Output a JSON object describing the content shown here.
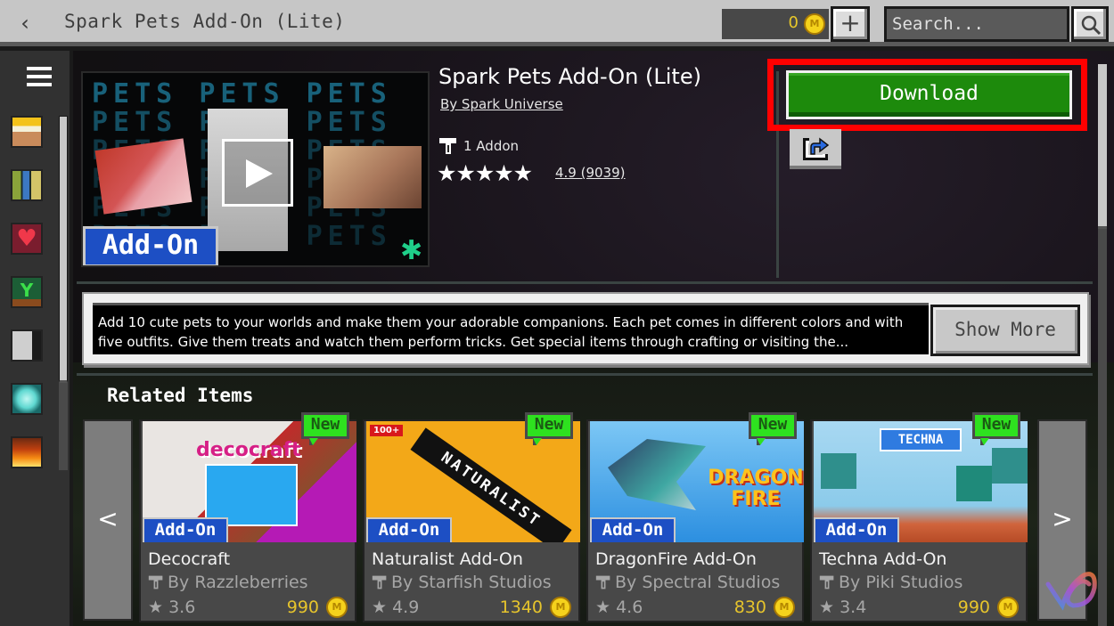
{
  "topbar": {
    "back_icon": "chevron-left-icon",
    "title": "Spark Pets Add-On (Lite)",
    "coins": "0",
    "coin_symbol": "M",
    "add_coins_label": "+",
    "search_placeholder": "Search..."
  },
  "sidebar": {
    "menu_icon": "hamburger-icon",
    "items": [
      {
        "name": "home-chest-icon"
      },
      {
        "name": "library-books-icon"
      },
      {
        "name": "wishlist-heart-icon"
      },
      {
        "name": "sprout-icon"
      },
      {
        "name": "skeleton-icon"
      },
      {
        "name": "diamond-icon"
      },
      {
        "name": "fire-icon"
      }
    ]
  },
  "product": {
    "thumbnail_bg_text": "PETS",
    "badge": "Add-On",
    "title": "Spark Pets Add-On (Lite)",
    "author": "By Spark Universe",
    "addon_count": "1 Addon",
    "stars": "★★★★★",
    "rating": "4.9 (9039)",
    "rating_value": 4.9,
    "download_label": "Download",
    "share_icon": "share-icon",
    "colors": {
      "download": "#1d8a0c",
      "highlight": "#ff0000"
    }
  },
  "description": {
    "text": "Add 10 cute pets to your worlds and make them your adorable companions. Each pet comes in different colors and with five outfits. Give them treats and watch them perform tricks. Get special items through crafting or visiting the...",
    "show_more_label": "Show More"
  },
  "related": {
    "heading": "Related Items",
    "prev_label": "<",
    "next_label": ">",
    "new_label": "New",
    "badge": "Add-On",
    "items": [
      {
        "name": "Decocraft",
        "author": "By Razzleberries",
        "rating": "★ 3.6",
        "price": "990",
        "thumb_logo": "decocraft"
      },
      {
        "name": "Naturalist Add-On",
        "author": "By Starfish Studios",
        "rating": "★ 4.9",
        "price": "1340",
        "thumb_logo": "NATURALIST",
        "thumb_tag": "100+"
      },
      {
        "name": "DragonFire Add-On",
        "author": "By Spectral Studios",
        "rating": "★ 4.6",
        "price": "830",
        "thumb_logo": "DRAGON FIRE"
      },
      {
        "name": "Techna Add-On",
        "author": "By Piki Studios",
        "rating": "★ 3.4",
        "price": "990",
        "thumb_logo": "TECHNA"
      }
    ]
  }
}
